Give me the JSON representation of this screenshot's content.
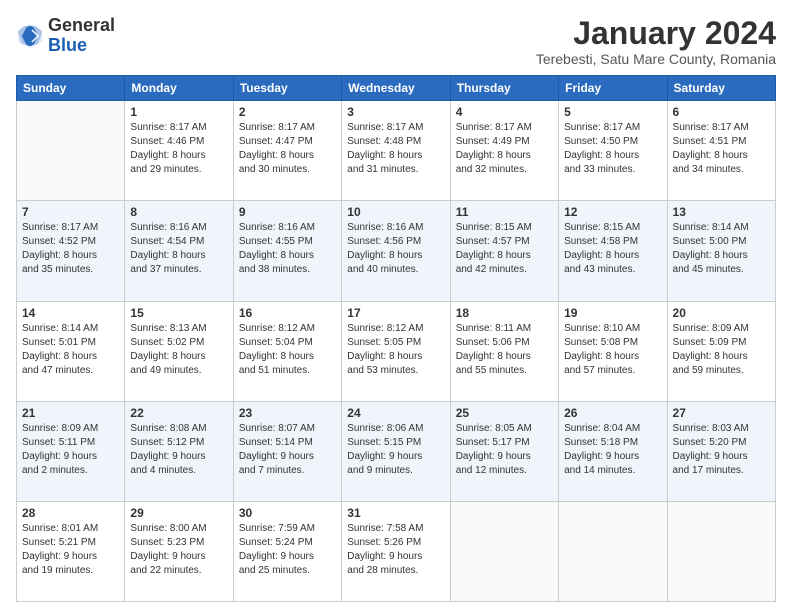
{
  "header": {
    "logo_general": "General",
    "logo_blue": "Blue",
    "main_title": "January 2024",
    "subtitle": "Terebesti, Satu Mare County, Romania"
  },
  "calendar": {
    "days_of_week": [
      "Sunday",
      "Monday",
      "Tuesday",
      "Wednesday",
      "Thursday",
      "Friday",
      "Saturday"
    ],
    "weeks": [
      {
        "alt": false,
        "days": [
          {
            "num": "",
            "info": ""
          },
          {
            "num": "1",
            "info": "Sunrise: 8:17 AM\nSunset: 4:46 PM\nDaylight: 8 hours\nand 29 minutes."
          },
          {
            "num": "2",
            "info": "Sunrise: 8:17 AM\nSunset: 4:47 PM\nDaylight: 8 hours\nand 30 minutes."
          },
          {
            "num": "3",
            "info": "Sunrise: 8:17 AM\nSunset: 4:48 PM\nDaylight: 8 hours\nand 31 minutes."
          },
          {
            "num": "4",
            "info": "Sunrise: 8:17 AM\nSunset: 4:49 PM\nDaylight: 8 hours\nand 32 minutes."
          },
          {
            "num": "5",
            "info": "Sunrise: 8:17 AM\nSunset: 4:50 PM\nDaylight: 8 hours\nand 33 minutes."
          },
          {
            "num": "6",
            "info": "Sunrise: 8:17 AM\nSunset: 4:51 PM\nDaylight: 8 hours\nand 34 minutes."
          }
        ]
      },
      {
        "alt": true,
        "days": [
          {
            "num": "7",
            "info": "Sunrise: 8:17 AM\nSunset: 4:52 PM\nDaylight: 8 hours\nand 35 minutes."
          },
          {
            "num": "8",
            "info": "Sunrise: 8:16 AM\nSunset: 4:54 PM\nDaylight: 8 hours\nand 37 minutes."
          },
          {
            "num": "9",
            "info": "Sunrise: 8:16 AM\nSunset: 4:55 PM\nDaylight: 8 hours\nand 38 minutes."
          },
          {
            "num": "10",
            "info": "Sunrise: 8:16 AM\nSunset: 4:56 PM\nDaylight: 8 hours\nand 40 minutes."
          },
          {
            "num": "11",
            "info": "Sunrise: 8:15 AM\nSunset: 4:57 PM\nDaylight: 8 hours\nand 42 minutes."
          },
          {
            "num": "12",
            "info": "Sunrise: 8:15 AM\nSunset: 4:58 PM\nDaylight: 8 hours\nand 43 minutes."
          },
          {
            "num": "13",
            "info": "Sunrise: 8:14 AM\nSunset: 5:00 PM\nDaylight: 8 hours\nand 45 minutes."
          }
        ]
      },
      {
        "alt": false,
        "days": [
          {
            "num": "14",
            "info": "Sunrise: 8:14 AM\nSunset: 5:01 PM\nDaylight: 8 hours\nand 47 minutes."
          },
          {
            "num": "15",
            "info": "Sunrise: 8:13 AM\nSunset: 5:02 PM\nDaylight: 8 hours\nand 49 minutes."
          },
          {
            "num": "16",
            "info": "Sunrise: 8:12 AM\nSunset: 5:04 PM\nDaylight: 8 hours\nand 51 minutes."
          },
          {
            "num": "17",
            "info": "Sunrise: 8:12 AM\nSunset: 5:05 PM\nDaylight: 8 hours\nand 53 minutes."
          },
          {
            "num": "18",
            "info": "Sunrise: 8:11 AM\nSunset: 5:06 PM\nDaylight: 8 hours\nand 55 minutes."
          },
          {
            "num": "19",
            "info": "Sunrise: 8:10 AM\nSunset: 5:08 PM\nDaylight: 8 hours\nand 57 minutes."
          },
          {
            "num": "20",
            "info": "Sunrise: 8:09 AM\nSunset: 5:09 PM\nDaylight: 8 hours\nand 59 minutes."
          }
        ]
      },
      {
        "alt": true,
        "days": [
          {
            "num": "21",
            "info": "Sunrise: 8:09 AM\nSunset: 5:11 PM\nDaylight: 9 hours\nand 2 minutes."
          },
          {
            "num": "22",
            "info": "Sunrise: 8:08 AM\nSunset: 5:12 PM\nDaylight: 9 hours\nand 4 minutes."
          },
          {
            "num": "23",
            "info": "Sunrise: 8:07 AM\nSunset: 5:14 PM\nDaylight: 9 hours\nand 7 minutes."
          },
          {
            "num": "24",
            "info": "Sunrise: 8:06 AM\nSunset: 5:15 PM\nDaylight: 9 hours\nand 9 minutes."
          },
          {
            "num": "25",
            "info": "Sunrise: 8:05 AM\nSunset: 5:17 PM\nDaylight: 9 hours\nand 12 minutes."
          },
          {
            "num": "26",
            "info": "Sunrise: 8:04 AM\nSunset: 5:18 PM\nDaylight: 9 hours\nand 14 minutes."
          },
          {
            "num": "27",
            "info": "Sunrise: 8:03 AM\nSunset: 5:20 PM\nDaylight: 9 hours\nand 17 minutes."
          }
        ]
      },
      {
        "alt": false,
        "days": [
          {
            "num": "28",
            "info": "Sunrise: 8:01 AM\nSunset: 5:21 PM\nDaylight: 9 hours\nand 19 minutes."
          },
          {
            "num": "29",
            "info": "Sunrise: 8:00 AM\nSunset: 5:23 PM\nDaylight: 9 hours\nand 22 minutes."
          },
          {
            "num": "30",
            "info": "Sunrise: 7:59 AM\nSunset: 5:24 PM\nDaylight: 9 hours\nand 25 minutes."
          },
          {
            "num": "31",
            "info": "Sunrise: 7:58 AM\nSunset: 5:26 PM\nDaylight: 9 hours\nand 28 minutes."
          },
          {
            "num": "",
            "info": ""
          },
          {
            "num": "",
            "info": ""
          },
          {
            "num": "",
            "info": ""
          }
        ]
      }
    ]
  }
}
